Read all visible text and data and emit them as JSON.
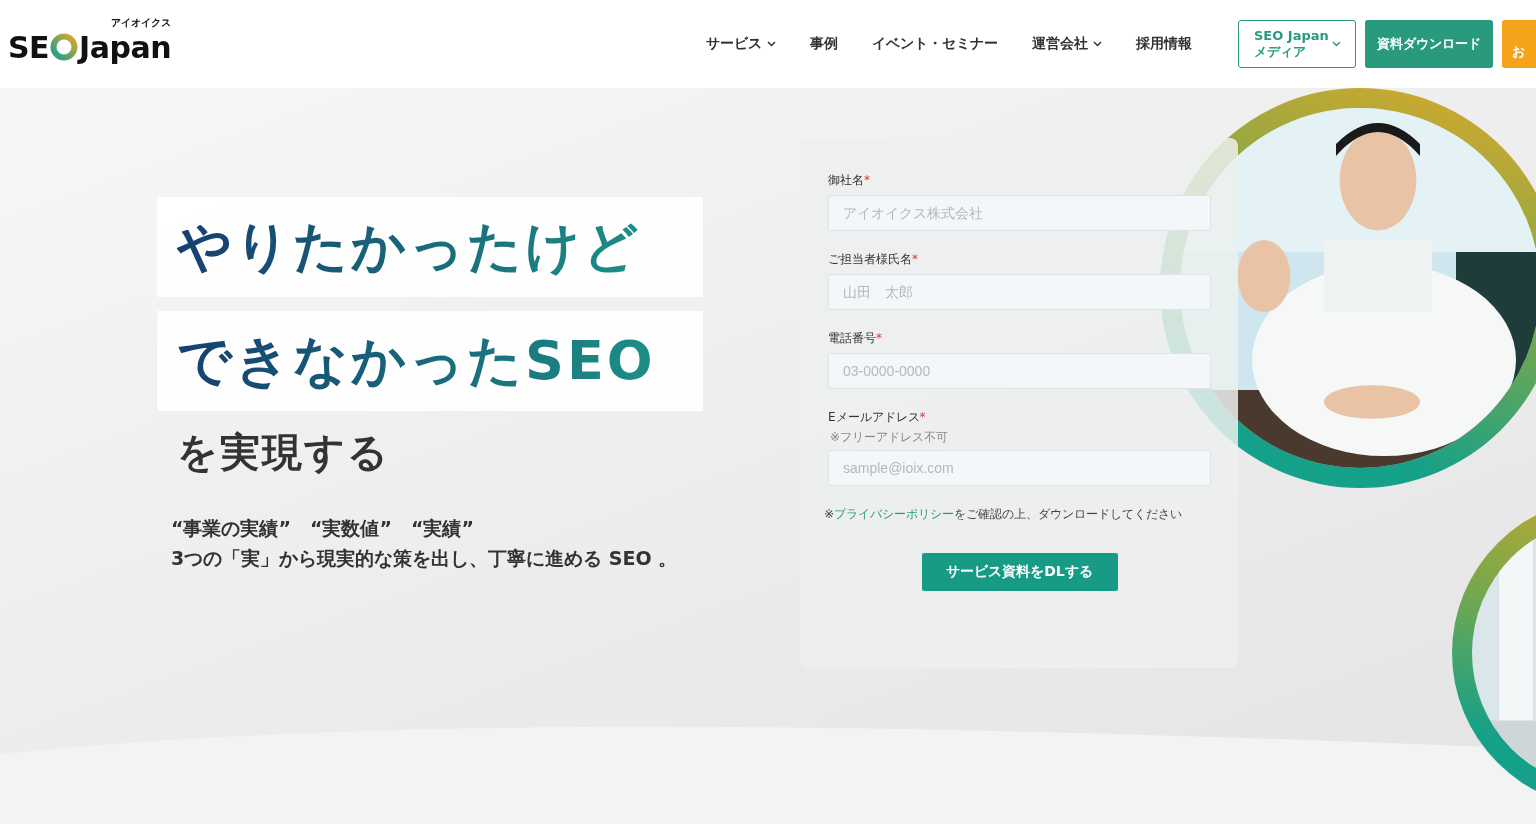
{
  "header": {
    "logo": {
      "text_1": "SE",
      "text_2": "Japan",
      "kana": "アイオイクス"
    },
    "nav": [
      {
        "label": "サービス",
        "dropdown": true
      },
      {
        "label": "事例",
        "dropdown": false
      },
      {
        "label": "イベント・セミナー",
        "dropdown": false
      },
      {
        "label": "運営会社",
        "dropdown": true
      },
      {
        "label": "採用情報",
        "dropdown": false
      }
    ],
    "media_button": {
      "line_1": "SEO Japan",
      "line_2": "メディア",
      "dropdown": true
    },
    "download_button": "資料ダウンロード",
    "contact_button": "お"
  },
  "hero": {
    "headline": [
      "やりたかったけど",
      "できなかったSEO"
    ],
    "subheadline": "を実現する",
    "lead_1": "“事業の実績”　“実数値”　“実績”",
    "lead_2": "3つの「実」から現実的な策を出し、丁寧に進める SEO 。"
  },
  "form": {
    "fields": [
      {
        "label": "御社名",
        "required_mark": "*",
        "placeholder": "アイオイクス株式会社"
      },
      {
        "label": "ご担当者様氏名",
        "required_mark": "*",
        "placeholder": "山田　太郎"
      },
      {
        "label": "電話番号",
        "required_mark": "*",
        "placeholder": "03-0000-0000"
      },
      {
        "label": "Eメールアドレス",
        "required_mark": "*",
        "note": "※フリーアドレス不可",
        "placeholder": "sample@ioix.com"
      }
    ],
    "privacy": {
      "prefix": "※",
      "link": "プライバシーポリシー",
      "suffix": "をご確認の上、ダウンロードしてください"
    },
    "submit": "サービス資料をDLする"
  }
}
